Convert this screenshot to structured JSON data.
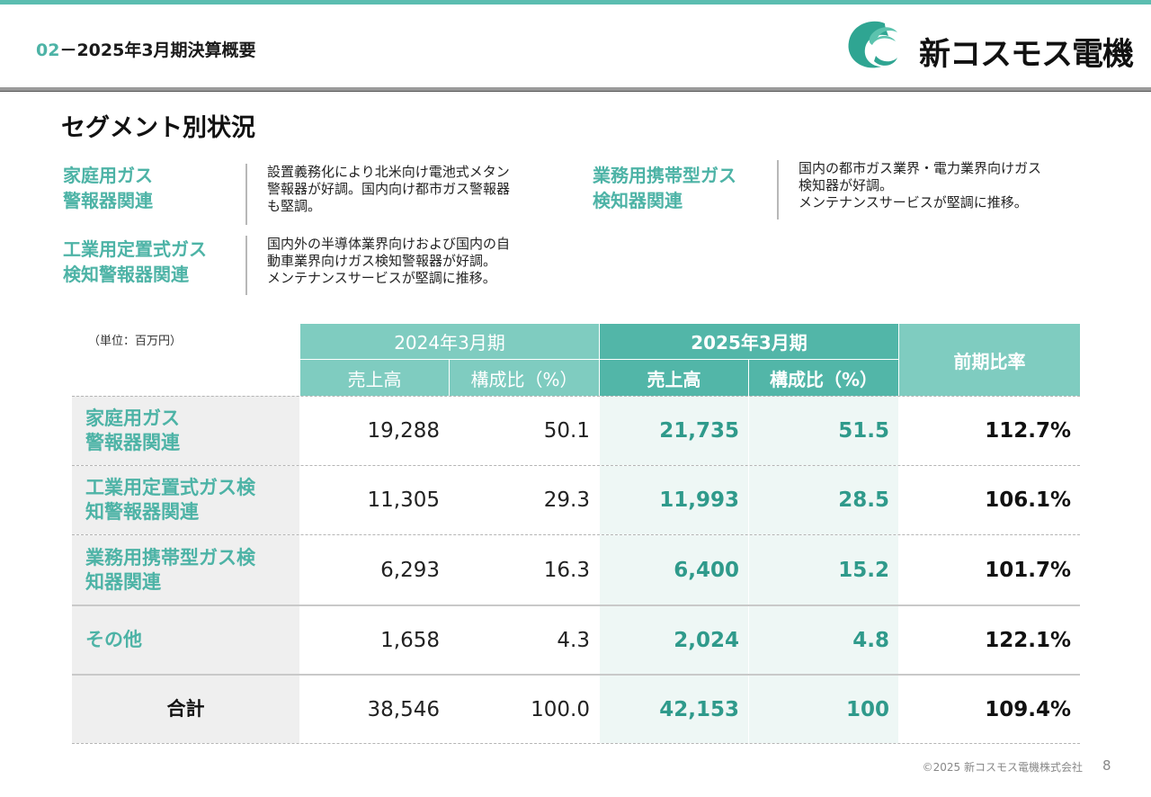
{
  "header": {
    "section_number": "02",
    "title": "－2025年3月期決算概要",
    "logo_text": "新コスモス電機",
    "colors": {
      "accent": "#5bbdb0",
      "header_light": "#7fccc0",
      "header_dark": "#52b6a8",
      "highlight_text": "#2f9a8b"
    }
  },
  "section_title": "セグメント別状況",
  "segments": [
    {
      "name_lines": [
        "家庭用ガス",
        "警報器関連"
      ],
      "desc_lines": [
        "設置義務化により北米向け電池式メタン",
        "警報器が好調。国内向け都市ガス警報器",
        "も堅調。"
      ]
    },
    {
      "name_lines": [
        "業務用携帯型ガス",
        "検知器関連"
      ],
      "desc_lines": [
        "国内の都市ガス業界・電力業界向けガス",
        "検知器が好調。",
        "メンテナンスサービスが堅調に推移。"
      ]
    },
    {
      "name_lines": [
        "工業用定置式ガス",
        "検知警報器関連"
      ],
      "desc_lines": [
        "国内外の半導体業界向けおよび国内の自",
        "動車業界向けガス検知警報器が好調。",
        "メンテナンスサービスが堅調に推移。"
      ]
    }
  ],
  "table": {
    "unit": "（単位：百万円）",
    "period_prev": "2024年3月期",
    "period_curr": "2025年3月期",
    "col_sales": "売上高",
    "col_ratio": "構成比（%）",
    "col_yoy": "前期比率",
    "rows": [
      {
        "label_lines": [
          "家庭用ガス",
          "警報器関連"
        ],
        "prev_sales": "19,288",
        "prev_ratio": "50.1",
        "curr_sales": "21,735",
        "curr_ratio": "51.5",
        "yoy": "112.7%"
      },
      {
        "label_lines": [
          "工業用定置式ガス検",
          "知警報器関連"
        ],
        "prev_sales": "11,305",
        "prev_ratio": "29.3",
        "curr_sales": "11,993",
        "curr_ratio": "28.5",
        "yoy": "106.1%"
      },
      {
        "label_lines": [
          "業務用携帯型ガス検",
          "知器関連"
        ],
        "prev_sales": "6,293",
        "prev_ratio": "16.3",
        "curr_sales": "6,400",
        "curr_ratio": "15.2",
        "yoy": "101.7%"
      },
      {
        "label_lines": [
          "その他"
        ],
        "prev_sales": "1,658",
        "prev_ratio": "4.3",
        "curr_sales": "2,024",
        "curr_ratio": "4.8",
        "yoy": "122.1%"
      },
      {
        "label_lines": [
          "合計"
        ],
        "prev_sales": "38,546",
        "prev_ratio": "100.0",
        "curr_sales": "42,153",
        "curr_ratio": "100",
        "yoy": "109.4%"
      }
    ]
  },
  "footer": {
    "copyright": "©2025 新コスモス電機株式会社",
    "page": "8"
  }
}
